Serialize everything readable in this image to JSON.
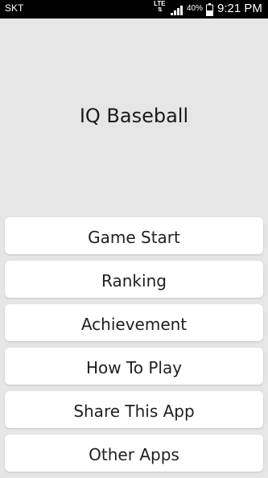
{
  "status_bar": {
    "carrier": "SKT",
    "network": "LTE",
    "battery_percent": "40%",
    "time": "9:21 PM"
  },
  "app": {
    "title": "IQ Baseball"
  },
  "menu": {
    "items": [
      {
        "label": "Game Start"
      },
      {
        "label": "Ranking"
      },
      {
        "label": "Achievement"
      },
      {
        "label": "How To Play"
      },
      {
        "label": "Share This App"
      },
      {
        "label": "Other Apps"
      }
    ]
  }
}
